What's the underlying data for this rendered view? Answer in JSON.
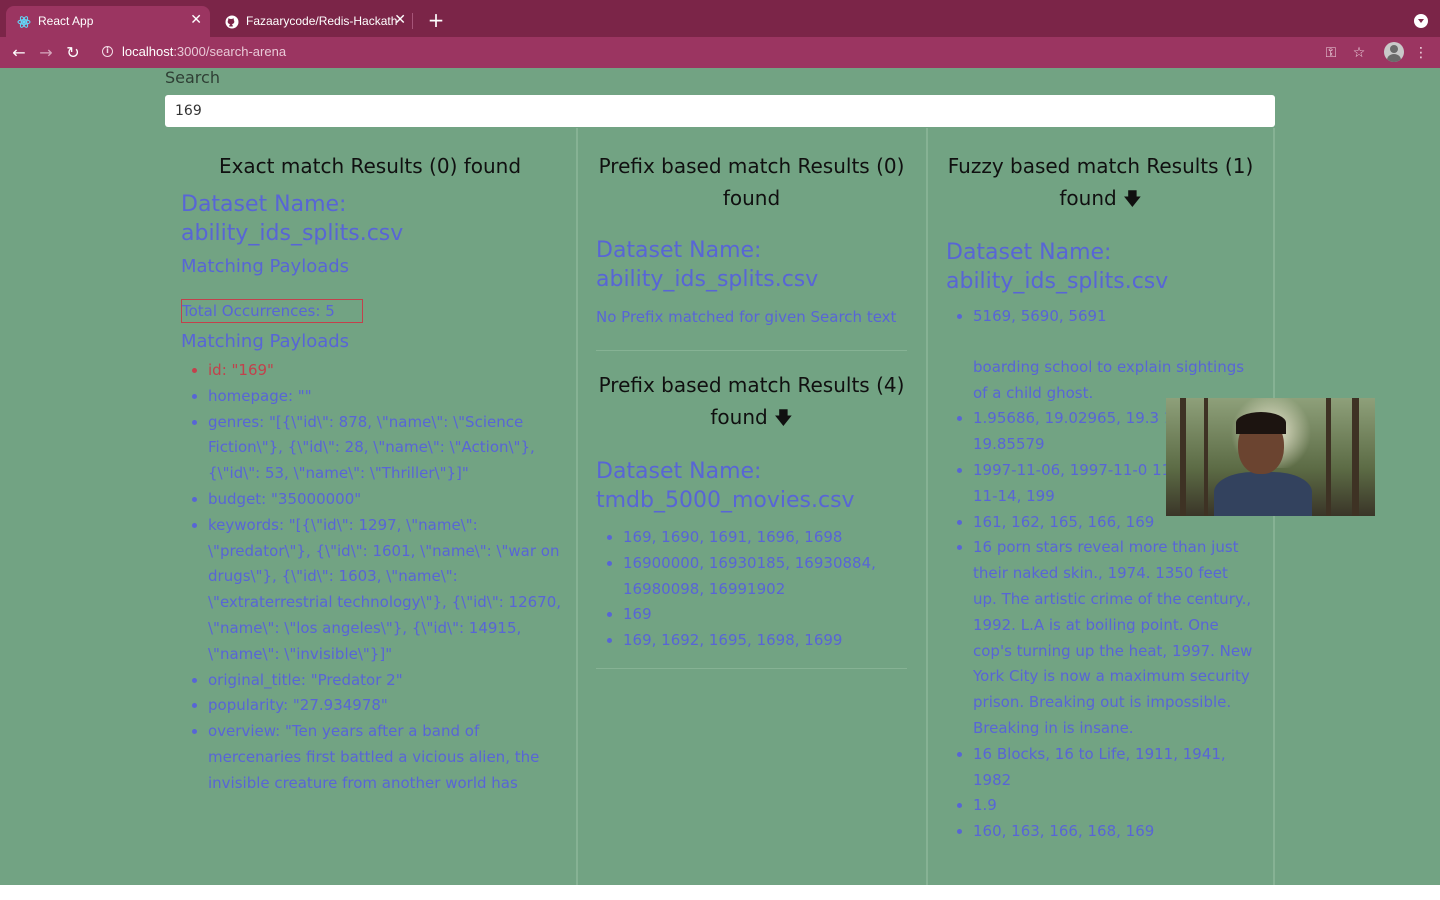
{
  "browser": {
    "tabs": [
      {
        "title": "React App",
        "active": true
      },
      {
        "title": "Fazaarycode/Redis-Hackathon",
        "active": false
      }
    ],
    "url_host": "localhost",
    "url_path": ":3000/search-arena"
  },
  "search": {
    "label": "Search",
    "value": "169"
  },
  "exact": {
    "heading": "Exact match Results (0) found",
    "dataset": "Dataset Name: ability_ids_splits.csv",
    "payloads_label_1": "Matching Payloads",
    "total": "Total Occurrences: 5",
    "payloads_label_2": "Matching Payloads",
    "items": [
      "id: \"169\"",
      "homepage: \"\"",
      "genres: \"[{\\\"id\\\": 878, \\\"name\\\": \\\"Science Fiction\\\"}, {\\\"id\\\": 28, \\\"name\\\": \\\"Action\\\"}, {\\\"id\\\": 53, \\\"name\\\": \\\"Thriller\\\"}]\"",
      "budget: \"35000000\"",
      "keywords: \"[{\\\"id\\\": 1297, \\\"name\\\": \\\"predator\\\"}, {\\\"id\\\": 1601, \\\"name\\\": \\\"war on drugs\\\"}, {\\\"id\\\": 1603, \\\"name\\\": \\\"extraterrestrial technology\\\"}, {\\\"id\\\": 12670, \\\"name\\\": \\\"los angeles\\\"}, {\\\"id\\\": 14915, \\\"name\\\": \\\"invisible\\\"}]\"",
      "original_title: \"Predator 2\"",
      "popularity: \"27.934978\"",
      "overview: \"Ten years after a band of mercenaries first battled a vicious alien, the invisible creature from another world has"
    ]
  },
  "prefix": {
    "heading_1": "Prefix based match Results (0) found",
    "dataset_1": "Dataset Name: ability_ids_splits.csv",
    "note": "No Prefix matched for given Search text",
    "heading_2": "Prefix based match Results (4) found",
    "arrow": "🡇",
    "dataset_2": "Dataset Name: tmdb_5000_movies.csv",
    "items": [
      "169, 1690, 1691, 1696, 1698",
      "16900000, 16930185, 16930884, 16980098, 16991902",
      "169",
      "169, 1692, 1695, 1698, 1699"
    ]
  },
  "fuzzy": {
    "heading": "Fuzzy based match Results (1) found",
    "arrow": "🡇",
    "dataset": "Dataset Name: ability_ids_splits.csv",
    "items": [
      "5169, 5690, 5691",
      "boarding school to explain sightings of a child ghost.",
      "1.95686, 19.02965, 19.3 19.83683, 19.85579",
      "1997-11-06, 1997-11-0 11-12, 1997-11-14, 199",
      "161, 162, 165, 166, 169",
      "16 porn stars reveal more than just their naked skin., 1974. 1350 feet up. The artistic crime of the century., 1992. L.A is at boiling point. One cop's turning up the heat, 1997. New York City is now a maximum security prison. Breaking out is impossible. Breaking in is insane.",
      "16 Blocks, 16 to Life, 1911, 1941, 1982",
      "1.9",
      "160, 163, 166, 168, 169"
    ]
  }
}
